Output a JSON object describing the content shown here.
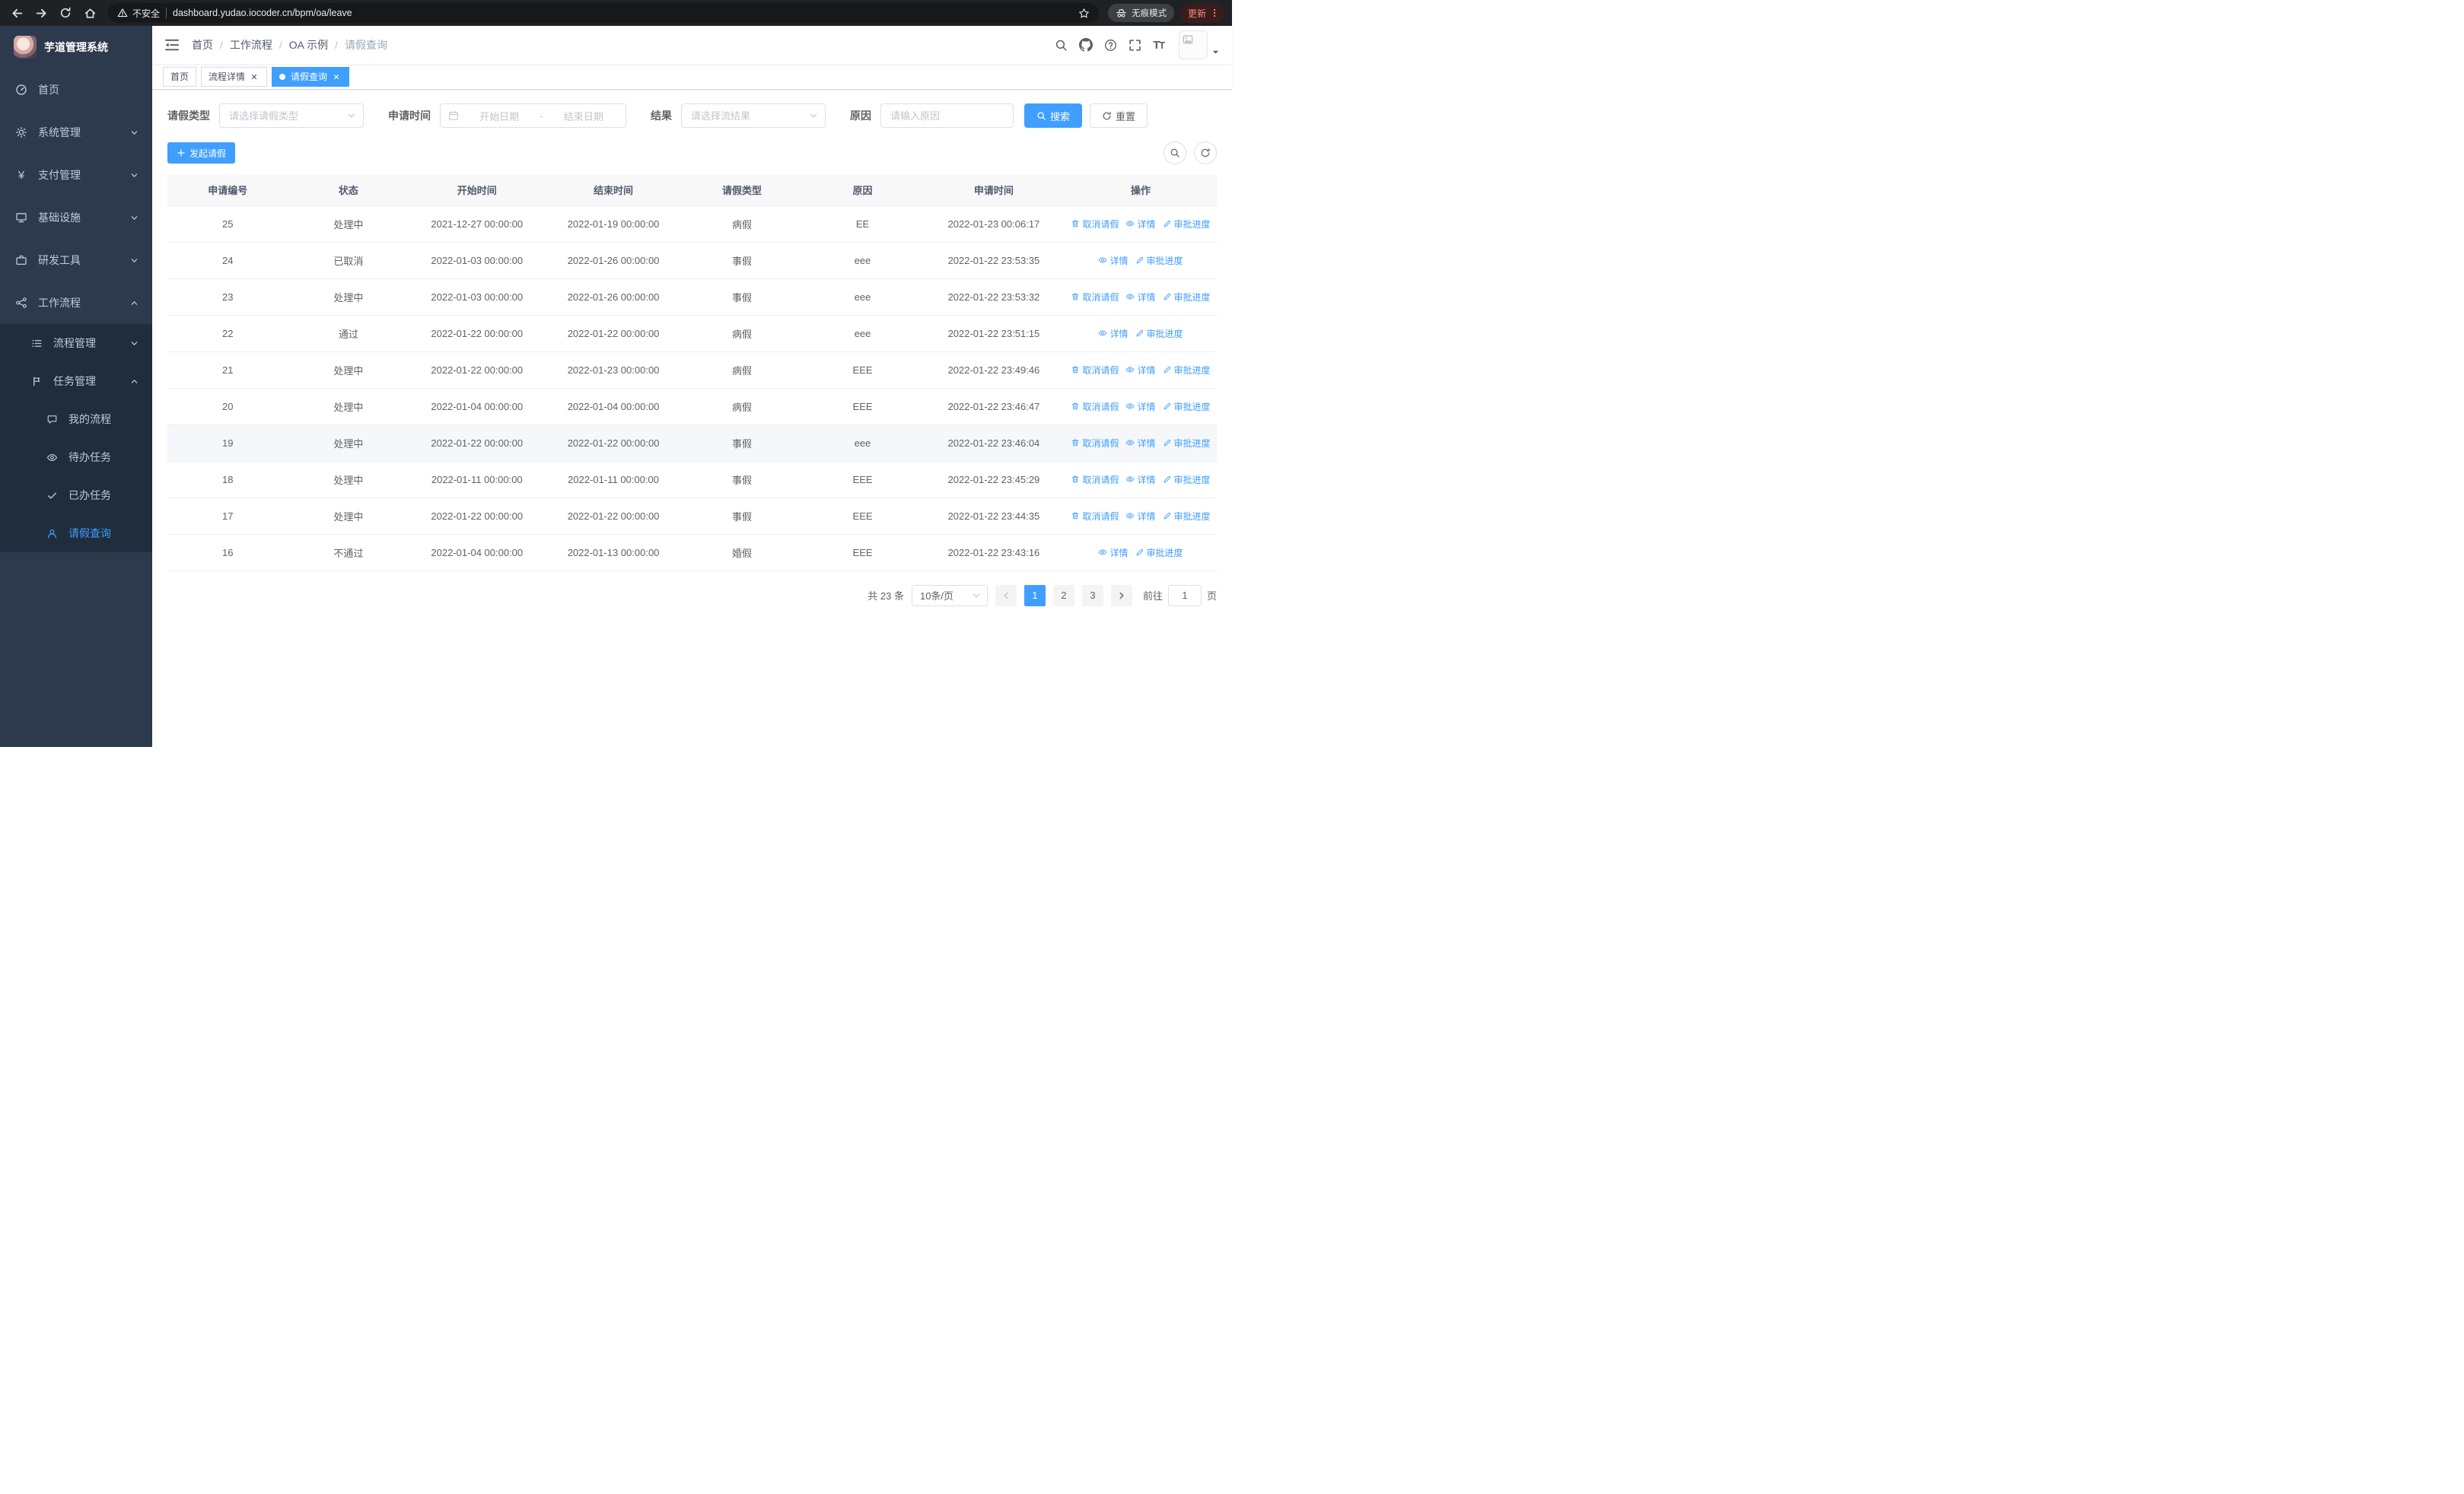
{
  "theme": {
    "primary": "#409eff",
    "sidebar_bg": "#2d3a4d",
    "submenu_bg": "#1f2d3d"
  },
  "browser": {
    "security": "不安全",
    "url": "dashboard.yudao.iocoder.cn/bpm/oa/leave",
    "incognito": "无痕模式",
    "update": "更新"
  },
  "sidebar": {
    "title": "芋道管理系统",
    "yen_glyph": "¥",
    "items_l1": [
      {
        "label": "首页"
      },
      {
        "label": "系统管理"
      },
      {
        "label": "支付管理"
      },
      {
        "label": "基础设施"
      },
      {
        "label": "研发工具"
      },
      {
        "label": "工作流程"
      }
    ],
    "items_l2": [
      {
        "label": "流程管理"
      },
      {
        "label": "任务管理"
      }
    ],
    "items_l3": [
      {
        "label": "我的流程"
      },
      {
        "label": "待办任务"
      },
      {
        "label": "已办任务"
      },
      {
        "label": "请假查询"
      }
    ]
  },
  "header": {
    "breadcrumb": [
      "首页",
      "工作流程",
      "OA 示例",
      "请假查询"
    ],
    "separator": "/"
  },
  "tabs": {
    "items": [
      {
        "label": "首页"
      },
      {
        "label": "流程详情"
      },
      {
        "label": "请假查询"
      }
    ]
  },
  "filters": {
    "leave_type_label": "请假类型",
    "leave_type_placeholder": "请选择请假类型",
    "apply_time_label": "申请时间",
    "start_date_placeholder": "开始日期",
    "range_separator": "-",
    "end_date_placeholder": "结束日期",
    "result_label": "结果",
    "result_placeholder": "请选择流结果",
    "reason_label": "原因",
    "reason_placeholder": "请输入原因",
    "search_button": "搜索",
    "reset_button": "重置"
  },
  "toolbar": {
    "create_button": "发起请假"
  },
  "table": {
    "columns": [
      "申请编号",
      "状态",
      "开始时间",
      "结束时间",
      "请假类型",
      "原因",
      "申请时间",
      "操作"
    ],
    "action_labels": {
      "cancel": "取消请假",
      "detail": "详情",
      "progress": "审批进度"
    },
    "rows": [
      {
        "id": "25",
        "status": "处理中",
        "start": "2021-12-27 00:00:00",
        "end": "2022-01-19 00:00:00",
        "type": "病假",
        "reason": "EE",
        "applied": "2022-01-23 00:06:17",
        "cancelable": true,
        "hover": false
      },
      {
        "id": "24",
        "status": "已取消",
        "start": "2022-01-03 00:00:00",
        "end": "2022-01-26 00:00:00",
        "type": "事假",
        "reason": "eee",
        "applied": "2022-01-22 23:53:35",
        "cancelable": false,
        "hover": false
      },
      {
        "id": "23",
        "status": "处理中",
        "start": "2022-01-03 00:00:00",
        "end": "2022-01-26 00:00:00",
        "type": "事假",
        "reason": "eee",
        "applied": "2022-01-22 23:53:32",
        "cancelable": true,
        "hover": false
      },
      {
        "id": "22",
        "status": "通过",
        "start": "2022-01-22 00:00:00",
        "end": "2022-01-22 00:00:00",
        "type": "病假",
        "reason": "eee",
        "applied": "2022-01-22 23:51:15",
        "cancelable": false,
        "hover": false
      },
      {
        "id": "21",
        "status": "处理中",
        "start": "2022-01-22 00:00:00",
        "end": "2022-01-23 00:00:00",
        "type": "病假",
        "reason": "EEE",
        "applied": "2022-01-22 23:49:46",
        "cancelable": true,
        "hover": false
      },
      {
        "id": "20",
        "status": "处理中",
        "start": "2022-01-04 00:00:00",
        "end": "2022-01-04 00:00:00",
        "type": "病假",
        "reason": "EEE",
        "applied": "2022-01-22 23:46:47",
        "cancelable": true,
        "hover": false
      },
      {
        "id": "19",
        "status": "处理中",
        "start": "2022-01-22 00:00:00",
        "end": "2022-01-22 00:00:00",
        "type": "事假",
        "reason": "eee",
        "applied": "2022-01-22 23:46:04",
        "cancelable": true,
        "hover": true
      },
      {
        "id": "18",
        "status": "处理中",
        "start": "2022-01-11 00:00:00",
        "end": "2022-01-11 00:00:00",
        "type": "事假",
        "reason": "EEE",
        "applied": "2022-01-22 23:45:29",
        "cancelable": true,
        "hover": false
      },
      {
        "id": "17",
        "status": "处理中",
        "start": "2022-01-22 00:00:00",
        "end": "2022-01-22 00:00:00",
        "type": "事假",
        "reason": "EEE",
        "applied": "2022-01-22 23:44:35",
        "cancelable": true,
        "hover": false
      },
      {
        "id": "16",
        "status": "不通过",
        "start": "2022-01-04 00:00:00",
        "end": "2022-01-13 00:00:00",
        "type": "婚假",
        "reason": "EEE",
        "applied": "2022-01-22 23:43:16",
        "cancelable": false,
        "hover": false
      }
    ]
  },
  "pagination": {
    "total": "共 23 条",
    "page_size": "10条/页",
    "pages": [
      "1",
      "2",
      "3"
    ],
    "goto_label": "前往",
    "goto_value": "1",
    "goto_suffix": "页"
  }
}
